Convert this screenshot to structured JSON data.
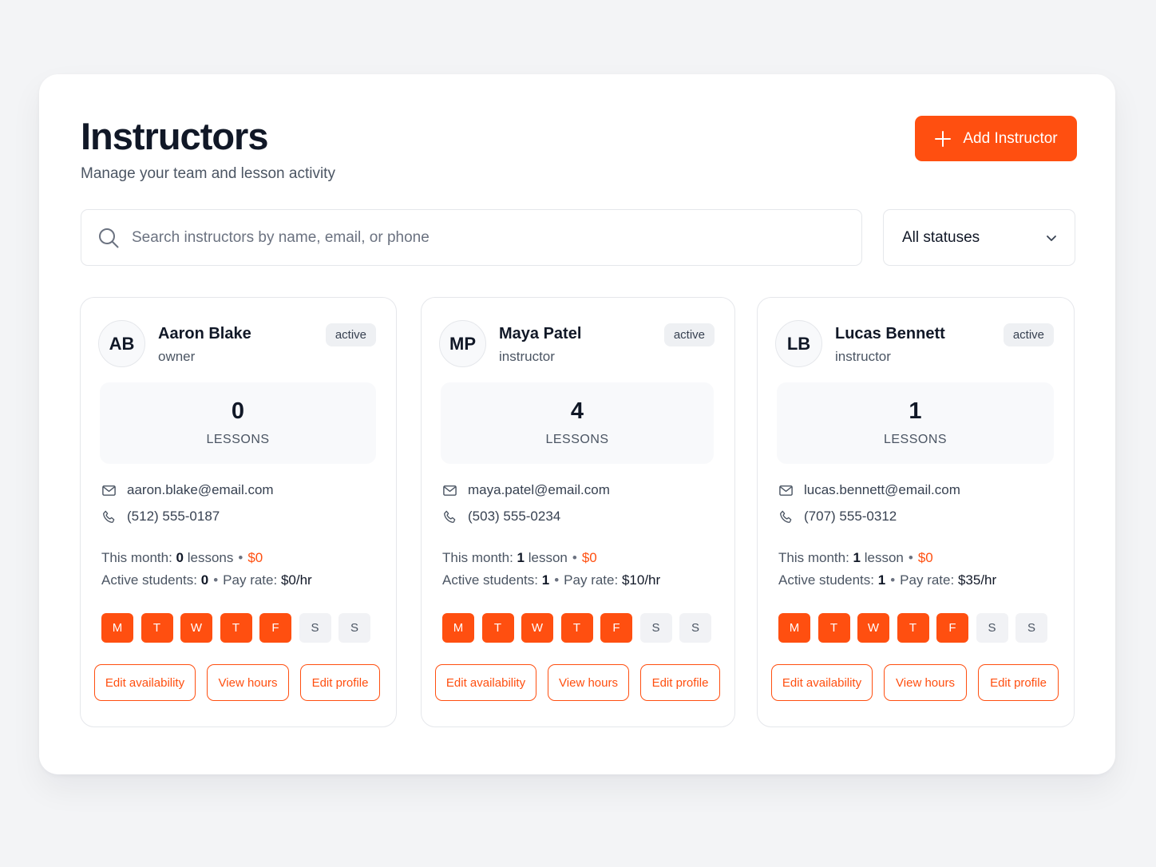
{
  "header": {
    "title": "Instructors",
    "subtitle": "Manage your team and lesson activity",
    "add_button_label": "Add Instructor"
  },
  "search": {
    "placeholder": "Search instructors by name, email, or phone",
    "value": ""
  },
  "status_filter": {
    "selected": "All statuses"
  },
  "colors": {
    "accent": "#ff4f10",
    "text": "#111827",
    "muted": "#4b5563"
  },
  "icons": {
    "add": "plus-icon",
    "search": "search-icon",
    "dropdown": "chevron-down-icon",
    "email": "mail-icon",
    "phone": "phone-icon"
  },
  "instructors": [
    {
      "initials": "AB",
      "name": "Aaron Blake",
      "role": "owner",
      "status": "active",
      "lessons_count": "0",
      "lessons_label": "LESSONS",
      "email": "aaron.blake@email.com",
      "phone": "(512) 555-0187",
      "this_month_label": "This month:",
      "this_month_count": "0",
      "this_month_unit": "lessons",
      "this_month_amount": "$0",
      "active_students_label": "Active students:",
      "active_students": "0",
      "pay_rate_label": "Pay rate:",
      "pay_rate": "$0/hr",
      "days": [
        {
          "label": "M",
          "on": true
        },
        {
          "label": "T",
          "on": true
        },
        {
          "label": "W",
          "on": true
        },
        {
          "label": "T",
          "on": true
        },
        {
          "label": "F",
          "on": true
        },
        {
          "label": "S",
          "on": false
        },
        {
          "label": "S",
          "on": false
        }
      ],
      "actions": [
        "Edit availability",
        "View hours",
        "Edit profile"
      ]
    },
    {
      "initials": "MP",
      "name": "Maya Patel",
      "role": "instructor",
      "status": "active",
      "lessons_count": "4",
      "lessons_label": "LESSONS",
      "email": "maya.patel@email.com",
      "phone": "(503) 555-0234",
      "this_month_label": "This month:",
      "this_month_count": "1",
      "this_month_unit": "lesson",
      "this_month_amount": "$0",
      "active_students_label": "Active students:",
      "active_students": "1",
      "pay_rate_label": "Pay rate:",
      "pay_rate": "$10/hr",
      "days": [
        {
          "label": "M",
          "on": true
        },
        {
          "label": "T",
          "on": true
        },
        {
          "label": "W",
          "on": true
        },
        {
          "label": "T",
          "on": true
        },
        {
          "label": "F",
          "on": true
        },
        {
          "label": "S",
          "on": false
        },
        {
          "label": "S",
          "on": false
        }
      ],
      "actions": [
        "Edit availability",
        "View hours",
        "Edit profile"
      ]
    },
    {
      "initials": "LB",
      "name": "Lucas Bennett",
      "role": "instructor",
      "status": "active",
      "lessons_count": "1",
      "lessons_label": "LESSONS",
      "email": "lucas.bennett@email.com",
      "phone": "(707) 555-0312",
      "this_month_label": "This month:",
      "this_month_count": "1",
      "this_month_unit": "lesson",
      "this_month_amount": "$0",
      "active_students_label": "Active students:",
      "active_students": "1",
      "pay_rate_label": "Pay rate:",
      "pay_rate": "$35/hr",
      "days": [
        {
          "label": "M",
          "on": true
        },
        {
          "label": "T",
          "on": true
        },
        {
          "label": "W",
          "on": true
        },
        {
          "label": "T",
          "on": true
        },
        {
          "label": "F",
          "on": true
        },
        {
          "label": "S",
          "on": false
        },
        {
          "label": "S",
          "on": false
        }
      ],
      "actions": [
        "Edit availability",
        "View hours",
        "Edit profile"
      ]
    }
  ]
}
